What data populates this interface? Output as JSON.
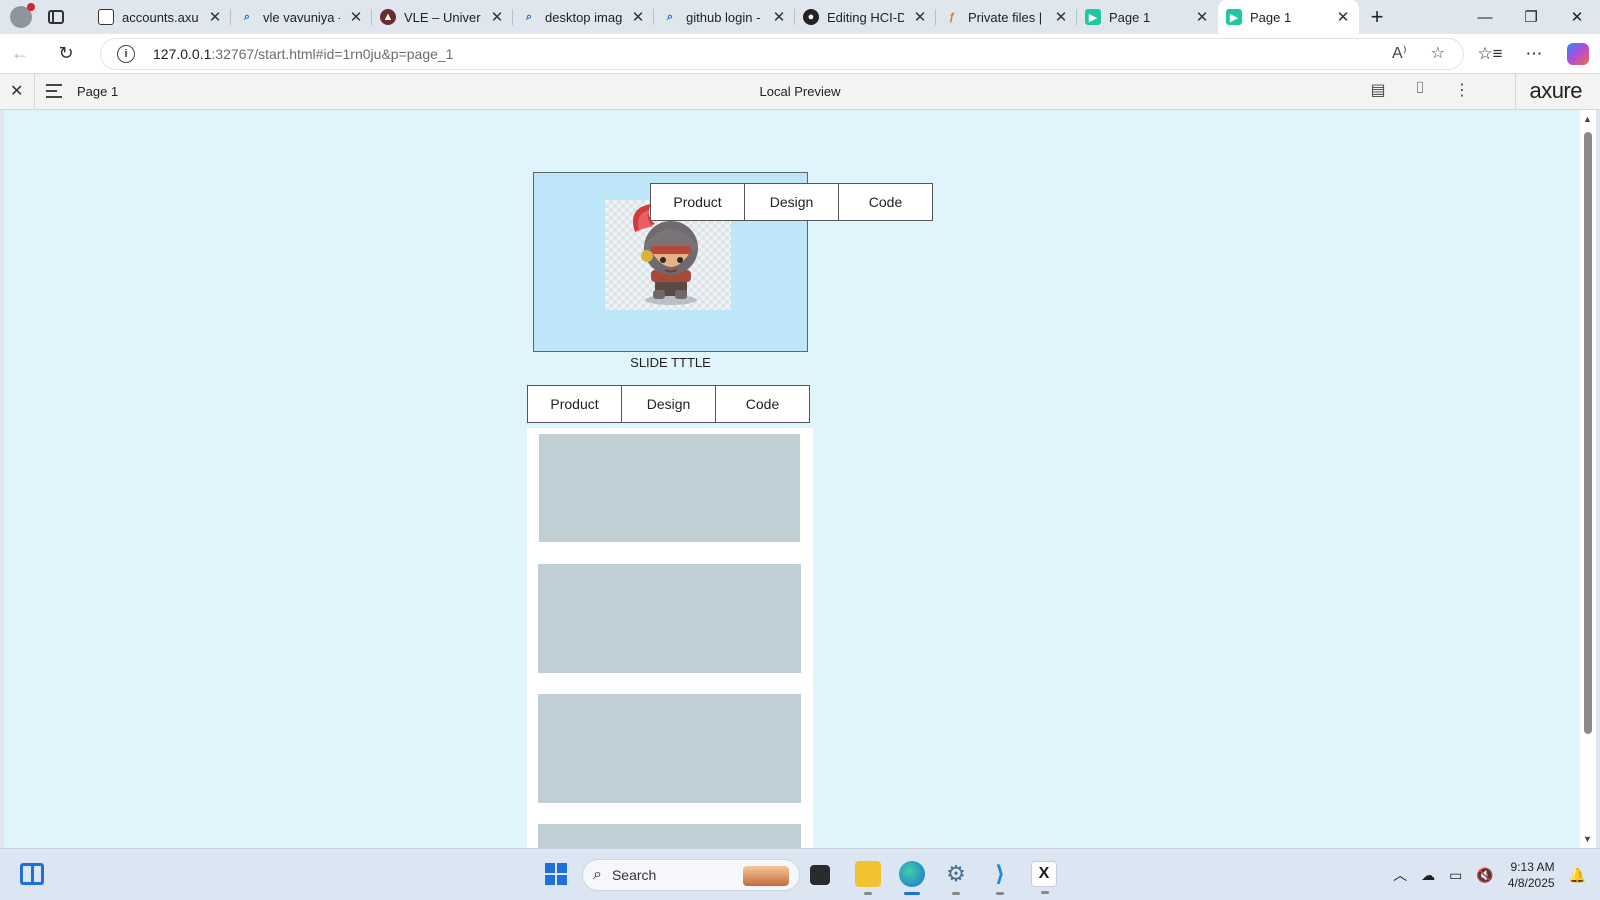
{
  "browser": {
    "tabs": [
      {
        "title": "accounts.axure.",
        "icon": "doc-icon",
        "active": false
      },
      {
        "title": "vle vavuniya - S",
        "icon": "search-icon",
        "active": false
      },
      {
        "title": "VLE – University",
        "icon": "university-icon",
        "active": false
      },
      {
        "title": "desktop images",
        "icon": "search-icon",
        "active": false
      },
      {
        "title": "github login - S",
        "icon": "search-icon",
        "active": false
      },
      {
        "title": "Editing HCI-Day",
        "icon": "github-icon",
        "active": false
      },
      {
        "title": "Private files | FA",
        "icon": "fa-icon",
        "active": false
      },
      {
        "title": "Page 1",
        "icon": "axure-icon",
        "active": false
      },
      {
        "title": "Page 1",
        "icon": "axure-icon",
        "active": true
      }
    ],
    "url_host": "127.0.0.1",
    "url_rest": ":32767/start.html#id=1rn0ju&p=page_1"
  },
  "axure": {
    "page_name": "Page 1",
    "center_label": "Local Preview",
    "logo": "axure"
  },
  "prototype": {
    "top_nav": [
      "Product",
      "Design",
      "Code"
    ],
    "slide_title": "SLIDE TTTLE",
    "bottom_nav": [
      "Product",
      "Design",
      "Code"
    ],
    "placeholder_count": 4
  },
  "taskbar": {
    "search_placeholder": "Search",
    "time": "9:13 AM",
    "date": "4/8/2025"
  },
  "colors": {
    "canvas_bg": "#e0f4fb",
    "slide_bg": "#bde7f8",
    "card_placeholder": "#c0ced6",
    "accent": "#1e6fd9"
  }
}
